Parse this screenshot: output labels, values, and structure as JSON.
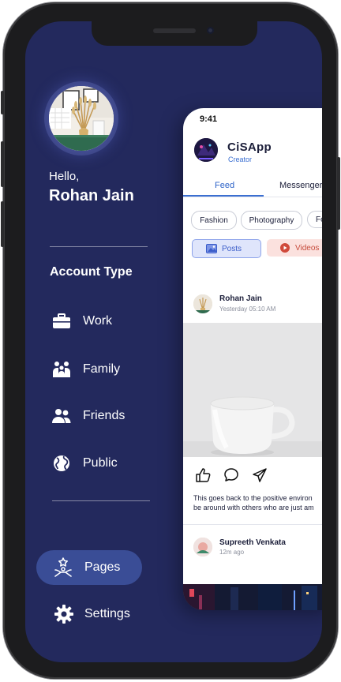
{
  "drawer": {
    "greeting": "Hello,",
    "user_name": "Rohan Jain",
    "section_title": "Account Type",
    "items": [
      {
        "label": "Work",
        "icon": "briefcase-icon"
      },
      {
        "label": "Family",
        "icon": "family-icon"
      },
      {
        "label": "Friends",
        "icon": "friends-icon"
      },
      {
        "label": "Public",
        "icon": "globe-icon"
      }
    ],
    "pages_label": "Pages",
    "settings_label": "Settings"
  },
  "app": {
    "time": "9:41",
    "name": "CiSApp",
    "role": "Creator",
    "tabs": [
      {
        "label": "Feed",
        "active": true
      },
      {
        "label": "Messenger",
        "active": false
      }
    ],
    "chips": [
      "Fashion",
      "Photography",
      "Fo"
    ],
    "segments": [
      {
        "label": "Posts",
        "icon": "image-icon",
        "selected": true
      },
      {
        "label": "Videos",
        "icon": "play-icon",
        "selected": false
      }
    ],
    "post": {
      "author": "Rohan Jain",
      "time": "Yesterday 05:10 AM",
      "caption_line1": "This goes back to the positive environ",
      "caption_line2": "be around with others who are just am"
    },
    "next_post": {
      "author": "Supreeth Venkata",
      "time": "12m ago"
    }
  },
  "colors": {
    "drawer_background": "#23295d",
    "selected_pill": "#3a4d96",
    "accent_blue": "#3b6fd1",
    "videos_red": "#c74b3c"
  }
}
